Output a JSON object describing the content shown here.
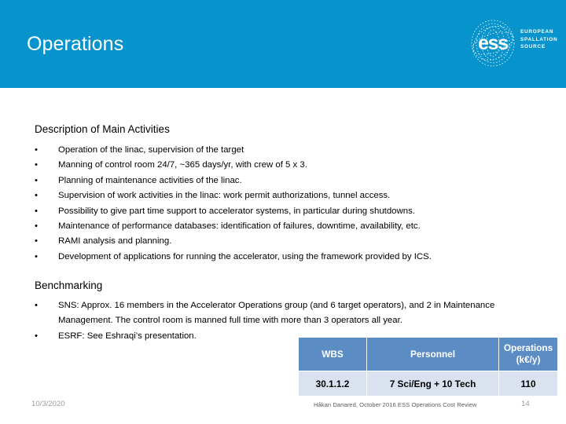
{
  "header": {
    "title": "Operations",
    "background_color": "#0793CB",
    "logo": {
      "mark_text": "ess",
      "line1": "EUROPEAN",
      "line2": "SPALLATION",
      "line3": "SOURCE"
    }
  },
  "main": {
    "sections": [
      {
        "heading": "Description of Main Activities",
        "bullet": "•",
        "items": [
          "Operation of the linac, supervision of the target",
          "Manning of control room 24/7, ~365 days/yr, with crew of  5 x 3.",
          "Planning of maintenance activities of the linac.",
          "Supervision of work activities in the linac: work permit authorizations, tunnel access.",
          "Possibility to give part time support to accelerator systems, in particular during shutdowns.",
          "Maintenance of performance databases: identification of failures, downtime, availability, etc.",
          "RAMI analysis and planning.",
          "Development of applications for running the accelerator, using the framework provided by ICS."
        ]
      },
      {
        "heading": "Benchmarking",
        "bullet": "•",
        "items": [
          "SNS: Approx. 16 members in the Accelerator Operations group (and 6 target operators), and 2 in Maintenance Management. The control room is manned full time with more than 3 operators all year.",
          "ESRF: See Eshraqi’s presentation."
        ]
      }
    ]
  },
  "cost_table": {
    "header_color": "#5B8CC4",
    "row_color": "#DBE2EF",
    "columns": [
      {
        "line1": "WBS",
        "line2": ""
      },
      {
        "line1": "Personnel",
        "line2": ""
      },
      {
        "line1": "Operations",
        "line2": "(k€/y)"
      }
    ],
    "rows": [
      {
        "wbs": "30.1.1.2",
        "personnel": "7 Sci/Eng + 10 Tech",
        "operations": "110"
      }
    ]
  },
  "footer": {
    "date": "10/3/2020",
    "center": "Håkan Danared, October 2016 ESS Operations Cost Review",
    "page_number": "14"
  }
}
